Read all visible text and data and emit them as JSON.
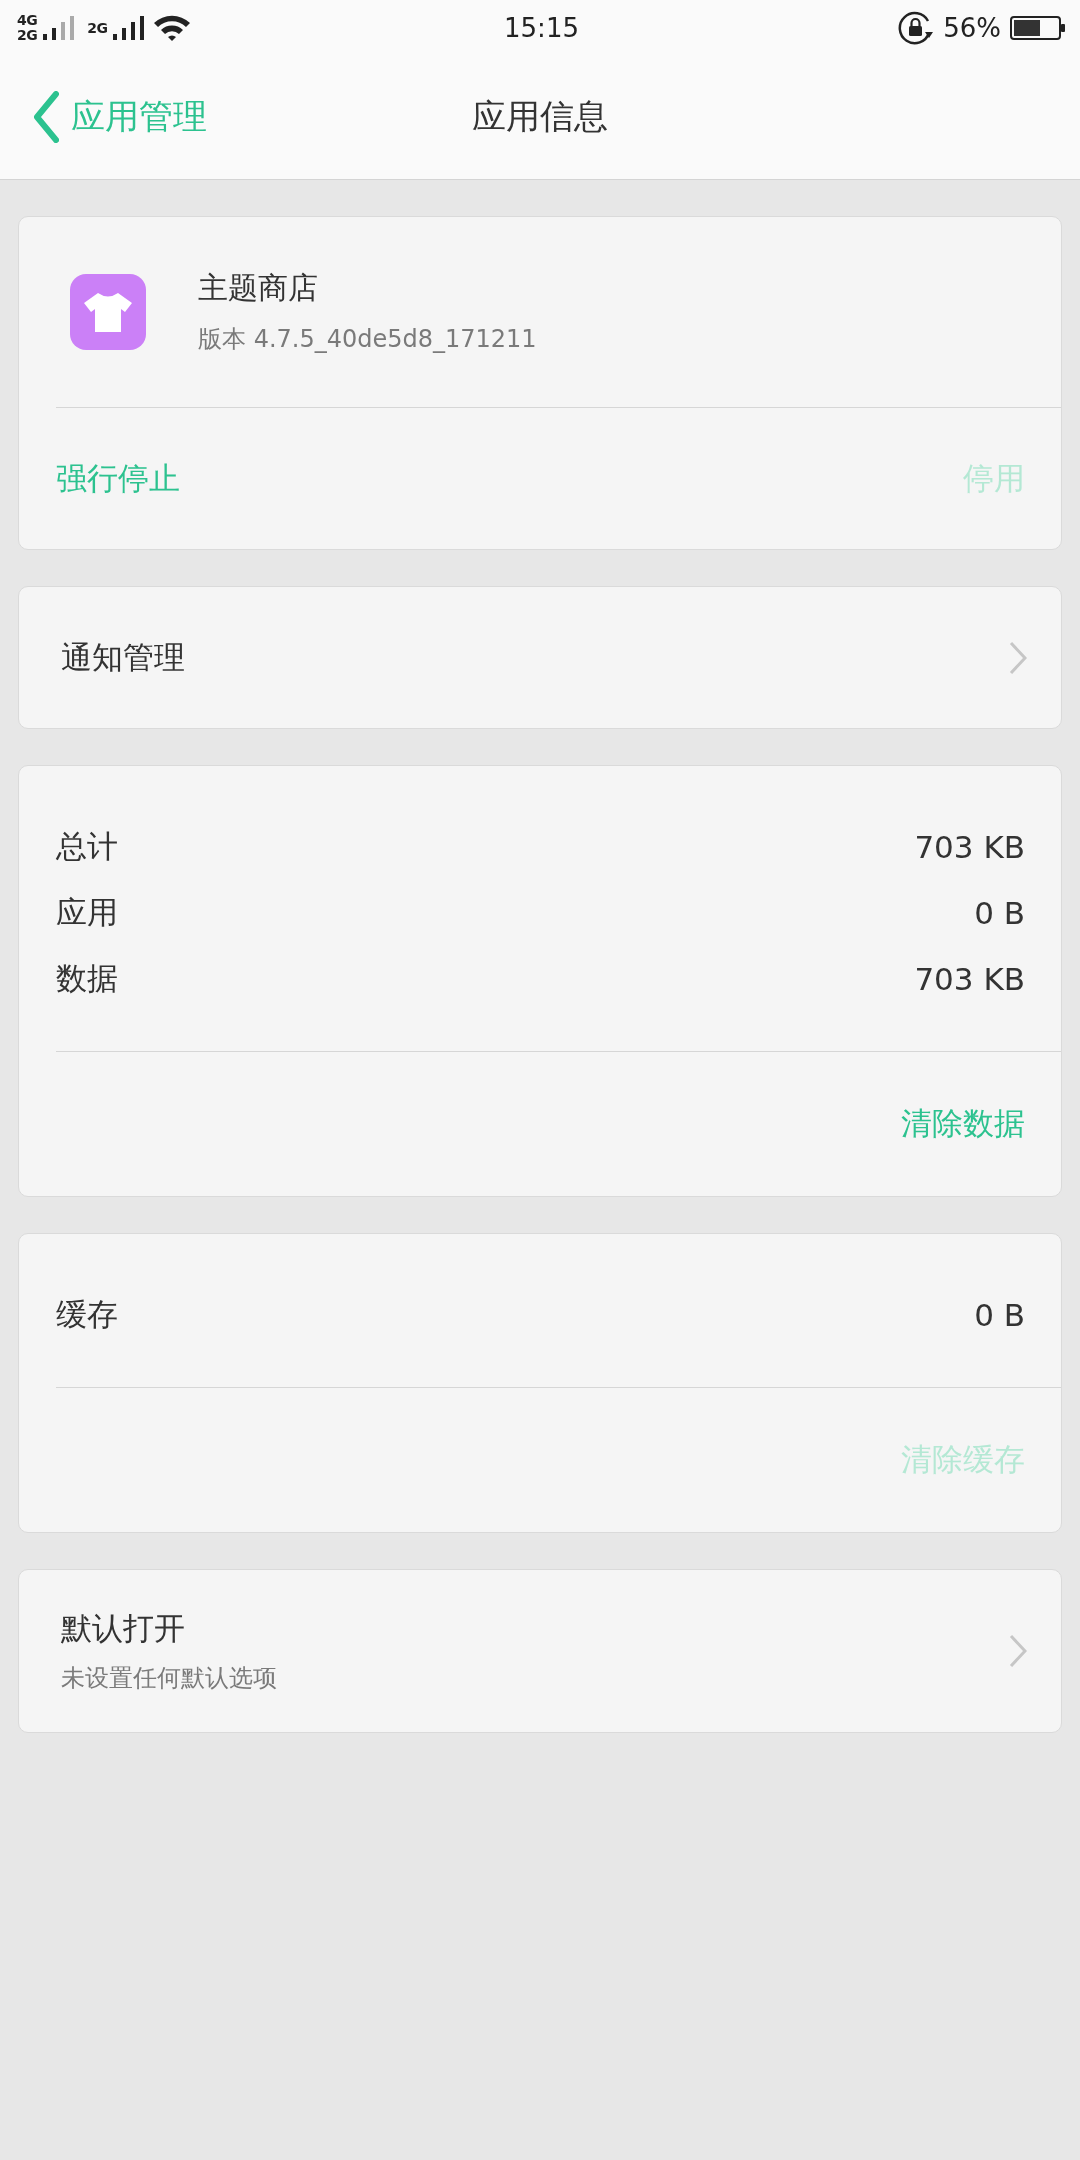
{
  "status_bar": {
    "sim_1": {
      "types": [
        "4G",
        "2G"
      ]
    },
    "sim_2": {
      "type": "2G"
    },
    "time": "15:15",
    "battery": "56%"
  },
  "header": {
    "back_label": "应用管理",
    "title": "应用信息"
  },
  "sections": [
    {
      "kind": "app",
      "name": "主题商店",
      "version": "版本 4.7.5_40de5d8_171211",
      "actions": [
        {
          "label": "强行停止",
          "disabled": false
        },
        {
          "label": "停用",
          "disabled": true
        }
      ]
    },
    {
      "kind": "link",
      "label": "通知管理"
    },
    {
      "kind": "stats",
      "rows": [
        {
          "label": "总计",
          "value": "703 KB"
        },
        {
          "label": "应用",
          "value": "0 B"
        },
        {
          "label": "数据",
          "value": "703 KB"
        }
      ],
      "action": {
        "label": "清除数据",
        "disabled": false
      }
    },
    {
      "kind": "stats",
      "rows": [
        {
          "label": "缓存",
          "value": "0 B"
        }
      ],
      "action": {
        "label": "清除缓存",
        "disabled": true
      }
    },
    {
      "kind": "link",
      "label": "默认打开",
      "subtitle": "未设置任何默认选项"
    }
  ]
}
